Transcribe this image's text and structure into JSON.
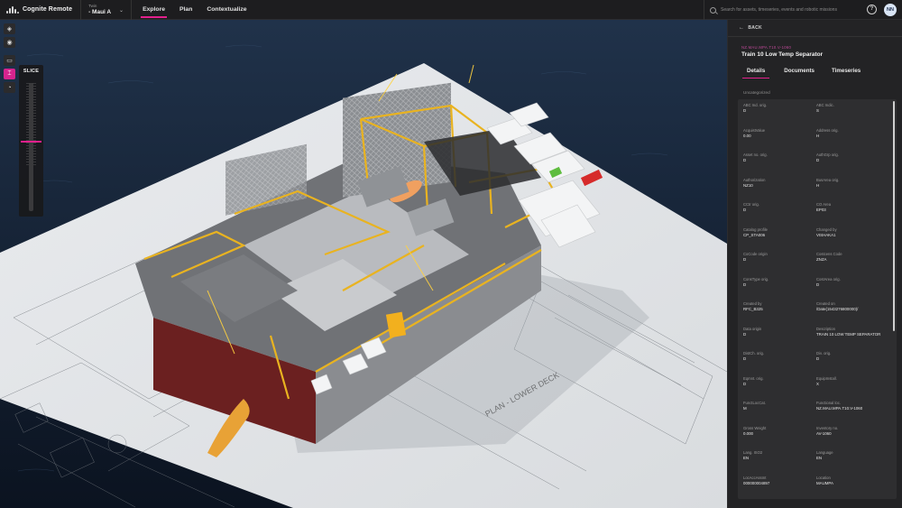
{
  "app": {
    "name": "Cognite Remote"
  },
  "twin": {
    "label": "Twin",
    "value": "- Maui A"
  },
  "nav": {
    "tabs": [
      {
        "label": "Explore"
      },
      {
        "label": "Plan"
      },
      {
        "label": "Contextualize"
      }
    ],
    "active": "Explore"
  },
  "search": {
    "placeholder": "Search for assets, timeseries, events and robotic missions"
  },
  "user": {
    "initials": "NN"
  },
  "slice": {
    "title": "SLICE",
    "level": 0.45
  },
  "panel": {
    "back_label": "BACK",
    "asset_code": "NZ.MAU.MPA.T10.V-1060",
    "asset_title": "Train 10 Low Temp Separator",
    "tabs": [
      {
        "label": "Details"
      },
      {
        "label": "Documents"
      },
      {
        "label": "Timeseries"
      }
    ],
    "active_tab": "Details",
    "section": "Uncategorized",
    "fields": [
      {
        "label": "ABC Ind. orig.",
        "value": "D"
      },
      {
        "label": "ABC Indic.",
        "value": "S"
      },
      {
        "label": "AcquistValue",
        "value": "0.00"
      },
      {
        "label": "Address orig.",
        "value": "H"
      },
      {
        "label": "Asset no. orig.",
        "value": "D"
      },
      {
        "label": "AuthGrp orig.",
        "value": "D"
      },
      {
        "label": "Authorization",
        "value": "NZ10"
      },
      {
        "label": "BusArea orig.",
        "value": "H"
      },
      {
        "label": "CCtr orig.",
        "value": "D"
      },
      {
        "label": "CO Area",
        "value": "EP03"
      },
      {
        "label": "Catalog profile",
        "value": "CP_STA006"
      },
      {
        "label": "Changed by",
        "value": "VISHAKA1"
      },
      {
        "label": "CoCode origin",
        "value": "D"
      },
      {
        "label": "Costcens Code",
        "value": "ZNZA"
      },
      {
        "label": "ConsType orig.",
        "value": "D"
      },
      {
        "label": "CostArea orig.",
        "value": "D"
      },
      {
        "label": "Created by",
        "value": "RFC_B325"
      },
      {
        "label": "Created on",
        "value": "/Date(1543276800000)/"
      },
      {
        "label": "Data origin",
        "value": "D"
      },
      {
        "label": "Description",
        "value": "TRAIN 10 LOW TEMP SEPARATOR"
      },
      {
        "label": "DistCh. orig.",
        "value": "D"
      },
      {
        "label": "Div. orig.",
        "value": "D"
      },
      {
        "label": "Eqmnt. orig.",
        "value": "D"
      },
      {
        "label": "EquipInstall.",
        "value": "X"
      },
      {
        "label": "FunctLocCat.",
        "value": "M"
      },
      {
        "label": "Functional loc.",
        "value": "NZ.MAU.MPA.T10.V-1060"
      },
      {
        "label": "Gross Weight",
        "value": "0.000"
      },
      {
        "label": "Inventory no.",
        "value": "AV-1060"
      },
      {
        "label": "Lang. ISO2",
        "value": "EN"
      },
      {
        "label": "Language",
        "value": "EN"
      },
      {
        "label": "LocAccAssmt",
        "value": "000000004897"
      },
      {
        "label": "Location",
        "value": "MAUMPA"
      }
    ]
  },
  "scene": {
    "drawing_title": "PLAN - LOWER DECK"
  },
  "colors": {
    "accent": "#e2208c",
    "panel_bg": "#232325",
    "topbar_bg": "#1d1d1f"
  }
}
